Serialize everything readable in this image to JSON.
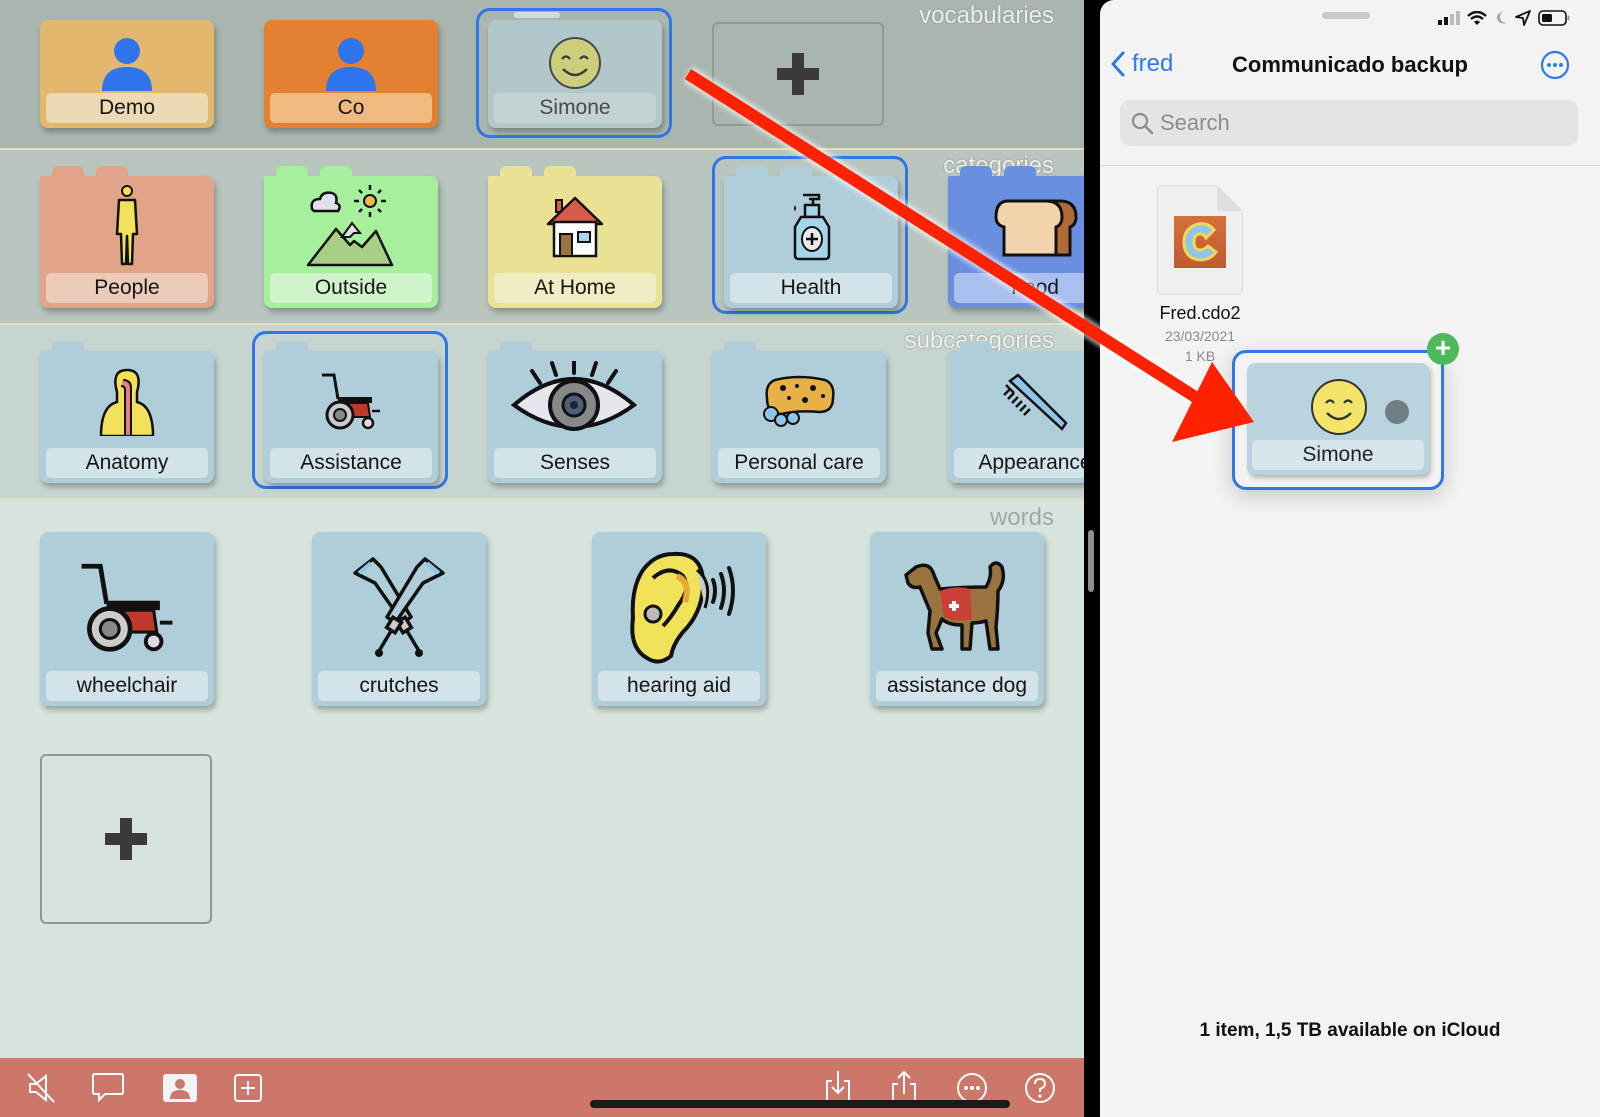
{
  "left_app": {
    "sections": {
      "vocabularies": "vocabularies",
      "categories": "categories",
      "subcategories": "subcategories",
      "words": "words"
    },
    "vocabularies": [
      {
        "label": "Demo",
        "icon": "person-icon",
        "color": "#e1b86e",
        "label_bg": "#ecdab5"
      },
      {
        "label": "Co",
        "icon": "person-icon",
        "color": "#e4802f",
        "label_bg": "#eeba80"
      },
      {
        "label": "Simone",
        "icon": "smiley-icon",
        "color": "#b2c8cc",
        "label_bg": "#c5d5d7",
        "selected": true,
        "dragging": true
      }
    ],
    "categories": [
      {
        "label": "People",
        "icon": "person-body-icon",
        "color": "#e2a488",
        "label_bg": "#edcbbb"
      },
      {
        "label": "Outside",
        "icon": "landscape-icon",
        "color": "#a6ef9c",
        "label_bg": "#cff4c9"
      },
      {
        "label": "At Home",
        "icon": "house-icon",
        "color": "#ebe194",
        "label_bg": "#f0ecc4"
      },
      {
        "label": "Health",
        "icon": "sanitizer-icon",
        "color": "#afced9",
        "label_bg": "#d3e3ea",
        "selected": true
      },
      {
        "label": "Food",
        "icon": "bread-icon",
        "color": "#6b8fe0",
        "label_bg": "#a9bfee"
      }
    ],
    "subcategories": [
      {
        "label": "Anatomy",
        "icon": "anatomy-icon"
      },
      {
        "label": "Assistance",
        "icon": "wheelchair-icon",
        "selected": true
      },
      {
        "label": "Senses",
        "icon": "eye-icon"
      },
      {
        "label": "Personal care",
        "icon": "sponge-icon"
      },
      {
        "label": "Appearance",
        "icon": "comb-icon"
      }
    ],
    "words": [
      {
        "label": "wheelchair",
        "icon": "wheelchair-icon"
      },
      {
        "label": "crutches",
        "icon": "crutches-icon"
      },
      {
        "label": "hearing aid",
        "icon": "hearing-aid-icon"
      },
      {
        "label": "assistance dog",
        "icon": "assistance-dog-icon"
      }
    ],
    "toolbar": {
      "left": [
        "mute-icon",
        "speech-bubble-icon",
        "profile-icon",
        "add-square-icon"
      ],
      "right": [
        "import-icon",
        "share-icon",
        "more-icon",
        "help-icon"
      ]
    },
    "colors": {
      "tile_blue": "#afced9",
      "tile_label_blue": "#d3e3ea",
      "selection": "#2f76e6",
      "toolbar": "#cd766a"
    }
  },
  "files_app": {
    "back_label": "fred",
    "title": "Communicado backup",
    "search_placeholder": "Search",
    "file": {
      "name": "Fred.cdo2",
      "date": "23/03/2021",
      "size": "1 KB"
    },
    "drag_item": {
      "label": "Simone",
      "badge": "+"
    },
    "footer": "1 item, 1,5 TB available on iCloud",
    "accent": "#2f7be6"
  }
}
